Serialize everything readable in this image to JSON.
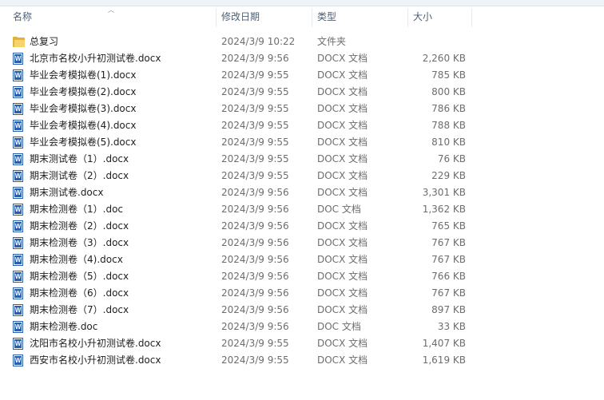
{
  "header": {
    "name": "名称",
    "date": "修改日期",
    "type": "类型",
    "size": "大小"
  },
  "colors": {
    "folder": "#f6d36b",
    "word": "#2b5fad",
    "header_text": "#4c5f75"
  },
  "files": [
    {
      "name": "总复习",
      "date": "2024/3/9 10:22",
      "type": "文件夹",
      "size": "",
      "icon": "folder-icon"
    },
    {
      "name": "北京市名校小升初测试卷.docx",
      "date": "2024/3/9 9:56",
      "type": "DOCX 文档",
      "size": "2,260 KB",
      "icon": "word-icon"
    },
    {
      "name": "毕业会考模拟卷(1).docx",
      "date": "2024/3/9 9:55",
      "type": "DOCX 文档",
      "size": "785 KB",
      "icon": "word-icon"
    },
    {
      "name": "毕业会考模拟卷(2).docx",
      "date": "2024/3/9 9:55",
      "type": "DOCX 文档",
      "size": "800 KB",
      "icon": "word-icon"
    },
    {
      "name": "毕业会考模拟卷(3).docx",
      "date": "2024/3/9 9:55",
      "type": "DOCX 文档",
      "size": "786 KB",
      "icon": "word-icon"
    },
    {
      "name": "毕业会考模拟卷(4).docx",
      "date": "2024/3/9 9:55",
      "type": "DOCX 文档",
      "size": "788 KB",
      "icon": "word-icon"
    },
    {
      "name": "毕业会考模拟卷(5).docx",
      "date": "2024/3/9 9:55",
      "type": "DOCX 文档",
      "size": "810 KB",
      "icon": "word-icon"
    },
    {
      "name": "期末测试卷（1）.docx",
      "date": "2024/3/9 9:55",
      "type": "DOCX 文档",
      "size": "76 KB",
      "icon": "word-icon"
    },
    {
      "name": "期末测试卷（2）.docx",
      "date": "2024/3/9 9:55",
      "type": "DOCX 文档",
      "size": "229 KB",
      "icon": "word-icon"
    },
    {
      "name": "期末测试卷.docx",
      "date": "2024/3/9 9:56",
      "type": "DOCX 文档",
      "size": "3,301 KB",
      "icon": "word-icon"
    },
    {
      "name": "期末检测卷（1）.doc",
      "date": "2024/3/9 9:56",
      "type": "DOC 文档",
      "size": "1,362 KB",
      "icon": "word-icon"
    },
    {
      "name": "期末检测卷（2）.docx",
      "date": "2024/3/9 9:56",
      "type": "DOCX 文档",
      "size": "765 KB",
      "icon": "word-icon"
    },
    {
      "name": "期末检测卷（3）.docx",
      "date": "2024/3/9 9:56",
      "type": "DOCX 文档",
      "size": "767 KB",
      "icon": "word-icon"
    },
    {
      "name": "期末检测卷（4).docx",
      "date": "2024/3/9 9:56",
      "type": "DOCX 文档",
      "size": "767 KB",
      "icon": "word-icon"
    },
    {
      "name": "期末检测卷（5）.docx",
      "date": "2024/3/9 9:56",
      "type": "DOCX 文档",
      "size": "766 KB",
      "icon": "word-icon"
    },
    {
      "name": "期末检测卷（6）.docx",
      "date": "2024/3/9 9:56",
      "type": "DOCX 文档",
      "size": "767 KB",
      "icon": "word-icon"
    },
    {
      "name": "期末检测卷（7）.docx",
      "date": "2024/3/9 9:56",
      "type": "DOCX 文档",
      "size": "897 KB",
      "icon": "word-icon"
    },
    {
      "name": "期末检测卷.doc",
      "date": "2024/3/9 9:56",
      "type": "DOC 文档",
      "size": "33 KB",
      "icon": "word-icon"
    },
    {
      "name": "沈阳市名校小升初测试卷.docx",
      "date": "2024/3/9 9:55",
      "type": "DOCX 文档",
      "size": "1,407 KB",
      "icon": "word-icon"
    },
    {
      "name": "西安市名校小升初测试卷.docx",
      "date": "2024/3/9 9:55",
      "type": "DOCX 文档",
      "size": "1,619 KB",
      "icon": "word-icon"
    }
  ]
}
